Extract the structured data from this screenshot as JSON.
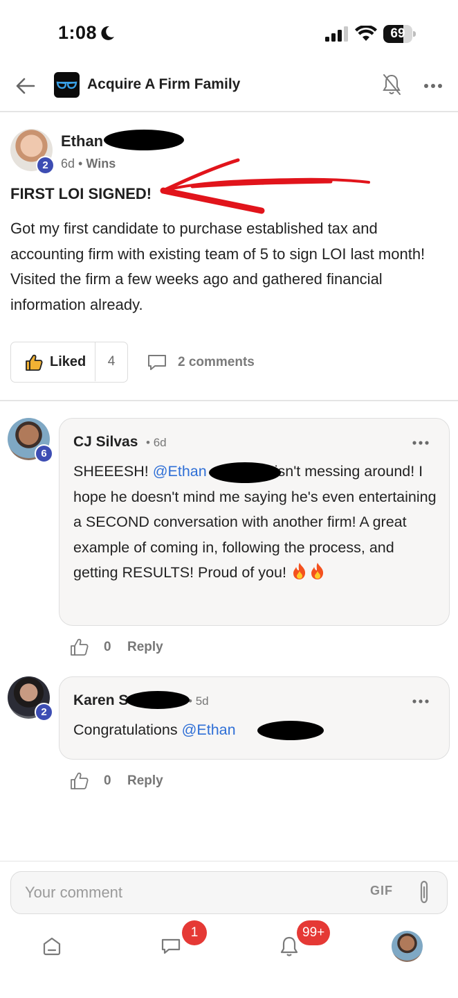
{
  "status_bar": {
    "time": "1:08",
    "battery": "69",
    "battery_level": 0.69,
    "icons": [
      "moon-icon",
      "signal-icon",
      "wifi-icon",
      "battery-icon"
    ]
  },
  "header": {
    "back_icon": "back-arrow-icon",
    "group_logo": "glasses-logo",
    "title": "Acquire A Firm Family",
    "mute_icon": "bell-off-icon",
    "more_icon": "more-horizontal-icon"
  },
  "post": {
    "author": "Ethan",
    "author_badge": "2",
    "age": "6d",
    "separator": "•",
    "category": "Wins",
    "title": "FIRST LOI SIGNED!",
    "body": "Got my first candidate to purchase established tax and accounting firm with existing team of 5 to sign LOI last month! Visited the firm a few weeks ago and gathered financial information already.",
    "like_label": "Liked",
    "like_count": "4",
    "comments_label": "2 comments"
  },
  "comments": [
    {
      "author": "CJ Silvas",
      "badge": "6",
      "age": "6d",
      "text_pre": "SHEEESH! ",
      "mention": "@Ethan",
      "text_post": "isn't messing around! I hope he doesn't mind me saying he's even entertaining a SECOND conversation with another firm! A great example of coming in, following the process, and getting RESULTS! Proud of you! ",
      "emoji": "fire-emoji",
      "like_count": "0",
      "reply_label": "Reply"
    },
    {
      "author": "Karen S",
      "badge": "2",
      "age": "5d",
      "text_pre": "Congratulations ",
      "mention": "@Ethan",
      "like_count": "0",
      "reply_label": "Reply"
    }
  ],
  "composer": {
    "placeholder": "Your comment",
    "gif_label": "GIF",
    "attach_icon": "paperclip-icon"
  },
  "tab_bar": {
    "home_icon": "home-icon",
    "messages_icon": "chat-icon",
    "messages_badge": "1",
    "notifications_icon": "bell-icon",
    "notifications_badge": "99+",
    "profile": "profile-avatar"
  },
  "colors": {
    "accent": "#2f6fd6",
    "badge": "#3d4db3",
    "alert": "#e53935",
    "annotation": "#e1141b"
  }
}
